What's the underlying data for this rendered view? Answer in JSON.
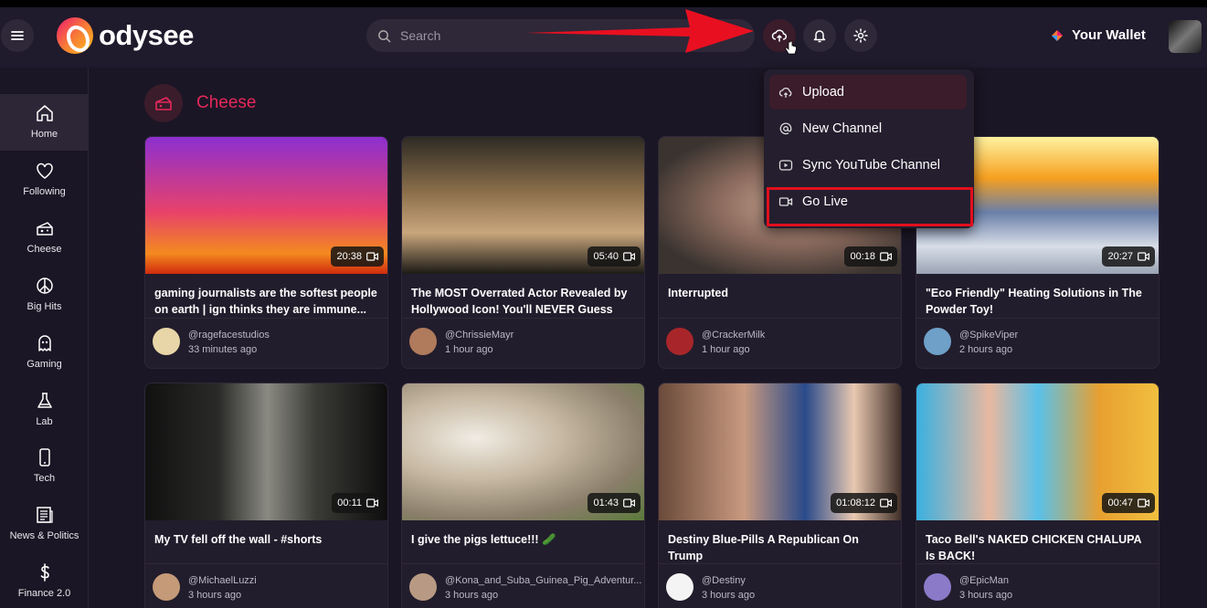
{
  "header": {
    "brand": "odysee",
    "search_placeholder": "Search",
    "wallet_label": "Your Wallet"
  },
  "sidebar": {
    "items": [
      {
        "label": "Home",
        "icon": "home-icon"
      },
      {
        "label": "Following",
        "icon": "heart-icon"
      },
      {
        "label": "Cheese",
        "icon": "cheese-icon"
      },
      {
        "label": "Big Hits",
        "icon": "peace-icon"
      },
      {
        "label": "Gaming",
        "icon": "ghost-icon"
      },
      {
        "label": "Lab",
        "icon": "flask-icon"
      },
      {
        "label": "Tech",
        "icon": "phone-icon"
      },
      {
        "label": "News & Politics",
        "icon": "newspaper-icon"
      },
      {
        "label": "Finance 2.0",
        "icon": "dollar-icon"
      }
    ]
  },
  "channel": {
    "title": "Cheese"
  },
  "menu": {
    "items": [
      {
        "label": "Upload",
        "icon": "upload-icon"
      },
      {
        "label": "New Channel",
        "icon": "at-icon"
      },
      {
        "label": "Sync YouTube Channel",
        "icon": "youtube-icon"
      },
      {
        "label": "Go Live",
        "icon": "video-camera-icon"
      }
    ]
  },
  "videos": [
    {
      "title": "gaming journalists are the softest people on earth | ign thinks they are immune...",
      "duration": "20:38",
      "channel": "@ragefacestudios",
      "time": "33 minutes ago"
    },
    {
      "title": "The MOST Overrated Actor Revealed by Hollywood Icon! You'll NEVER Guess Th...",
      "duration": "05:40",
      "channel": "@ChrissieMayr",
      "time": "1 hour ago"
    },
    {
      "title": "Interrupted",
      "duration": "00:18",
      "channel": "@CrackerMilk",
      "time": "1 hour ago"
    },
    {
      "title": "\"Eco Friendly\" Heating Solutions in The Powder Toy!",
      "duration": "20:27",
      "channel": "@SpikeViper",
      "time": "2 hours ago"
    },
    {
      "title": "My TV fell off the wall - #shorts",
      "duration": "00:11",
      "channel": "@MichaelLuzzi",
      "time": "3 hours ago"
    },
    {
      "title": "I give the pigs lettuce!!! 🥒",
      "duration": "01:43",
      "channel": "@Kona_and_Suba_Guinea_Pig_Adventur...",
      "time": "3 hours ago"
    },
    {
      "title": "Destiny Blue-Pills A Republican On Trump",
      "duration": "01:08:12",
      "channel": "@Destiny",
      "time": "3 hours ago"
    },
    {
      "title": "Taco Bell's NAKED CHICKEN CHALUPA Is BACK!",
      "duration": "00:47",
      "channel": "@EpicMan",
      "time": "3 hours ago"
    }
  ],
  "colors": {
    "accent": "#e5285a",
    "highlight_box": "#e10f1d",
    "arrow": "#e81020"
  }
}
